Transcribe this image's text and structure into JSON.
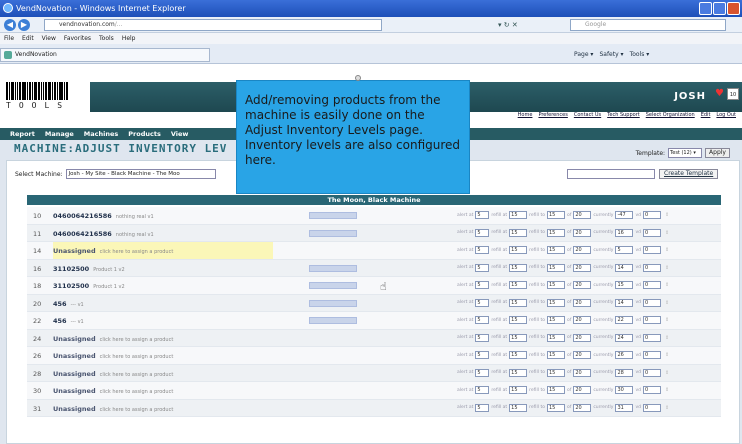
{
  "window": {
    "title": "VendNovation - Windows Internet Explorer"
  },
  "address": {
    "url_domain": "vendnovation.com",
    "url_rest": "/...",
    "search_placeholder": "Google"
  },
  "menu": [
    "File",
    "Edit",
    "View",
    "Favorites",
    "Tools",
    "Help"
  ],
  "tab": {
    "label": "VendNovation"
  },
  "ie_commands": [
    "Page ▾",
    "Safety ▾",
    "Tools ▾"
  ],
  "header": {
    "logo_text": "TOOLS",
    "user": "JOSH",
    "top_links": [
      "Home",
      "Preferences",
      "Contact Us",
      "Tech Support",
      "Select Organization",
      "Edit",
      "Log Out"
    ]
  },
  "nav": [
    "Report",
    "Manage",
    "Machines",
    "Products",
    "View"
  ],
  "page": {
    "title": "MACHINE:ADJUST INVENTORY LEV",
    "template_label": "Template:",
    "template_value": "Test (12)",
    "apply_label": "Apply",
    "machine_label": "Select Machine:",
    "machine_value": "Josh - My Site - Black Machine - The Moo",
    "create_template_label": "Create Template",
    "machine_bar": "The Moon, Black Machine"
  },
  "row_labels": {
    "alert": "alert at",
    "refill": "refill at",
    "refill_to": "refill to",
    "of": "of",
    "currently": "currently",
    "vend": "vd"
  },
  "rows": [
    {
      "slot": "10",
      "code": "0460064216586",
      "desc": "nothing real v1",
      "tag": "",
      "alert": "5",
      "refill": "15",
      "refill_to": "15",
      "of": "20",
      "current": "-47",
      "vd": "0"
    },
    {
      "slot": "11",
      "code": "0460064216586",
      "desc": "nothing real v1",
      "tag": "",
      "alert": "5",
      "refill": "15",
      "refill_to": "15",
      "of": "20",
      "current": "16",
      "vd": "0"
    },
    {
      "slot": "14",
      "code": "Unassigned",
      "desc": "click here to assign a product",
      "tag": "",
      "alert": "5",
      "refill": "15",
      "refill_to": "15",
      "of": "20",
      "current": "5",
      "vd": "0"
    },
    {
      "slot": "16",
      "code": "31102500",
      "desc": "Product 1 v2",
      "tag": "",
      "alert": "5",
      "refill": "15",
      "refill_to": "15",
      "of": "20",
      "current": "14",
      "vd": "0"
    },
    {
      "slot": "18",
      "code": "31102500",
      "desc": "Product 1 v2",
      "tag": "",
      "alert": "5",
      "refill": "15",
      "refill_to": "15",
      "of": "20",
      "current": "15",
      "vd": "0"
    },
    {
      "slot": "20",
      "code": "456",
      "desc": "--- v1",
      "tag": "",
      "alert": "5",
      "refill": "15",
      "refill_to": "15",
      "of": "20",
      "current": "14",
      "vd": "0"
    },
    {
      "slot": "22",
      "code": "456",
      "desc": "--- v1",
      "tag": "",
      "alert": "5",
      "refill": "15",
      "refill_to": "15",
      "of": "20",
      "current": "22",
      "vd": "0"
    },
    {
      "slot": "24",
      "code": "Unassigned",
      "desc": "click here to assign a product",
      "tag": "",
      "alert": "5",
      "refill": "15",
      "refill_to": "15",
      "of": "20",
      "current": "24",
      "vd": "0"
    },
    {
      "slot": "26",
      "code": "Unassigned",
      "desc": "click here to assign a product",
      "tag": "",
      "alert": "5",
      "refill": "15",
      "refill_to": "15",
      "of": "20",
      "current": "26",
      "vd": "0"
    },
    {
      "slot": "28",
      "code": "Unassigned",
      "desc": "click here to assign a product",
      "tag": "",
      "alert": "5",
      "refill": "15",
      "refill_to": "15",
      "of": "20",
      "current": "28",
      "vd": "0"
    },
    {
      "slot": "30",
      "code": "Unassigned",
      "desc": "click here to assign a product",
      "tag": "",
      "alert": "5",
      "refill": "15",
      "refill_to": "15",
      "of": "20",
      "current": "30",
      "vd": "0"
    },
    {
      "slot": "31",
      "code": "Unassigned",
      "desc": "click here to assign a product",
      "tag": "",
      "alert": "5",
      "refill": "15",
      "refill_to": "15",
      "of": "20",
      "current": "31",
      "vd": "0"
    }
  ],
  "tooltip": {
    "text": "Add/removing products from the machine is easily done on the Adjust Inventory Levels page. Inventory levels are also configured here."
  },
  "colors": {
    "header_band": "#2c5e68",
    "nav": "#275b63",
    "tooltip": "#29a4e6",
    "title": "#2a6d7c"
  }
}
